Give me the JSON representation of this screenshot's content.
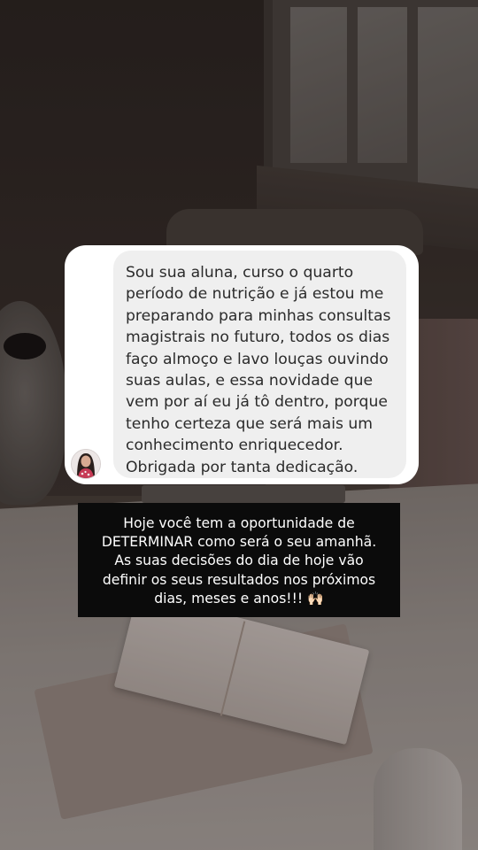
{
  "message": {
    "lines": [
      "Sou sua aluna, curso o quarto",
      "período de nutrição e já estou me",
      "preparando para minhas consultas",
      "magistrais no futuro, todos os dias",
      "faço almoço e lavo louças ouvindo",
      "suas aulas, e essa novidade que",
      "vem por aí eu já tô dentro, porque",
      "tenho certeza que será mais um",
      "conhecimento enriquecedor.",
      "Obrigada por tanta dedicação."
    ]
  },
  "caption": {
    "lines": [
      "Hoje você tem a oportunidade de",
      "DETERMINAR como será o seu amanhã.",
      "As suas decisões do dia de hoje vão",
      "definir os seus resultados nos próximos",
      "dias, meses e anos!!!"
    ],
    "emoji": "🙌🏻"
  },
  "icons": {
    "avatar": "profile-photo-icon"
  },
  "colors": {
    "card": "#ffffff",
    "bubble": "#efefef",
    "caption_bg": "#0b0b0b",
    "caption_text": "#ffffff"
  }
}
